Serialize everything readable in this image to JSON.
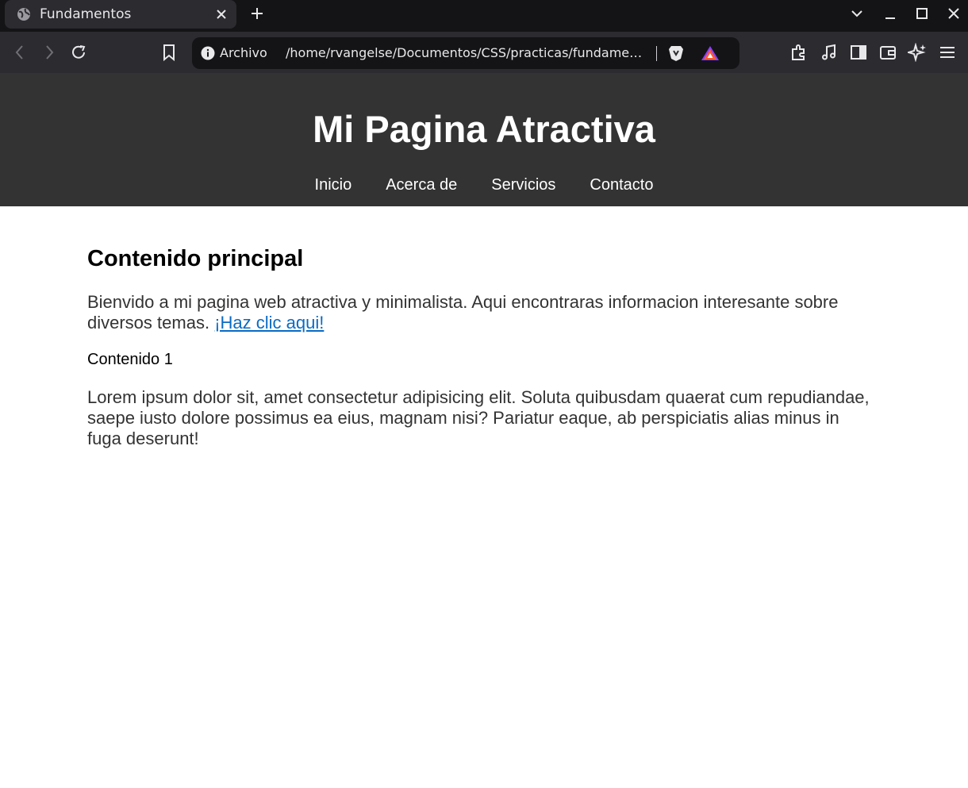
{
  "browser": {
    "tab_title": "Fundamentos",
    "url_scheme": "Archivo",
    "url_path": "/home/rvangelse/Documentos/CSS/practicas/fundamentos/index.html",
    "colors": {
      "tabbar": "#141416",
      "toolbar": "#2b2b30",
      "urlbar": "#141416"
    }
  },
  "site": {
    "title": "Mi Pagina Atractiva",
    "nav": [
      "Inicio",
      "Acerca de",
      "Servicios",
      "Contacto"
    ],
    "header_color": "#333333"
  },
  "main": {
    "heading": "Contenido principal",
    "intro_text": "Bienvido a mi pagina web atractiva y minimalista. Aqui encontraras informacion interesante sobre diversos temas.",
    "intro_link": "¡Haz clic aqui!",
    "subheading": "Contenido 1",
    "lorem": "Lorem ipsum dolor sit, amet consectetur adipisicing elit. Soluta quibusdam quaerat cum repudiandae, saepe iusto dolore possimus ea eius, magnam nisi? Pariatur eaque, ab perspiciatis alias minus in fuga deserunt!",
    "link_color": "#0a6bc4"
  }
}
